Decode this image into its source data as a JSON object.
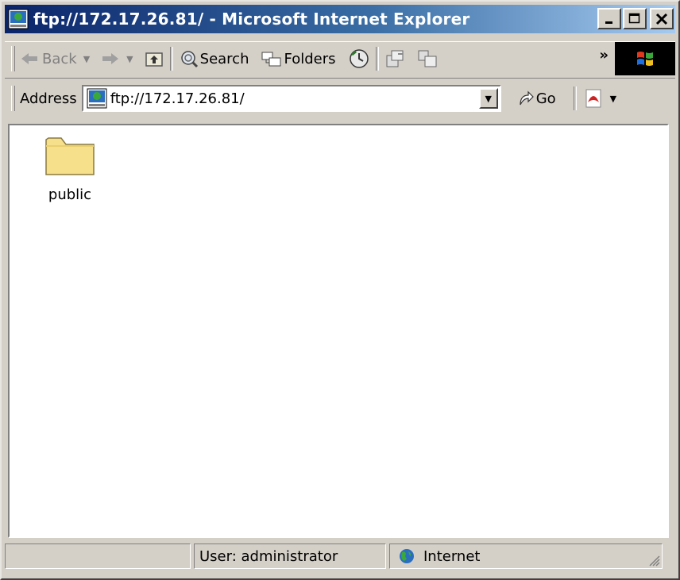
{
  "window": {
    "title": "ftp://172.17.26.81/ - Microsoft Internet Explorer",
    "buttons": [
      "minimize",
      "maximize",
      "close"
    ]
  },
  "toolbar": {
    "back_label": "Back",
    "search_label": "Search",
    "folders_label": "Folders",
    "overflow_label": "»",
    "icons": [
      "back-arrow-icon",
      "forward-arrow-icon",
      "up-folder-icon",
      "search-icon",
      "folders-icon",
      "history-icon",
      "move-to-icon",
      "copy-to-icon",
      "windows-logo-icon"
    ]
  },
  "address": {
    "label": "Address",
    "url": "ftp://172.17.26.81/",
    "go_label": "Go"
  },
  "content": {
    "items": [
      {
        "name": "public",
        "type": "folder"
      }
    ]
  },
  "statusbar": {
    "pane1": "",
    "user": "User: administrator",
    "zone": "Internet"
  },
  "colors": {
    "titlebar_start": "#0a246a",
    "titlebar_end": "#a6caf0",
    "chrome": "#d4d0c8",
    "folder": "#f7e08c"
  }
}
